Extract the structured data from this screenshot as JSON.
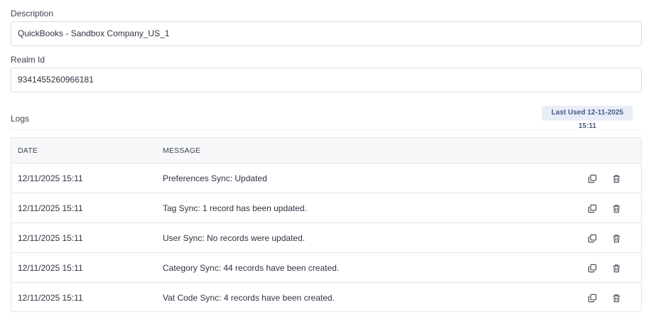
{
  "description": {
    "label": "Description",
    "value": "QuickBooks - Sandbox Company_US_1"
  },
  "realm": {
    "label": "Realm Id",
    "value": "9341455260966181"
  },
  "logs": {
    "title": "Logs",
    "last_used_badge": "Last Used 12-11-2025 15:11",
    "columns": {
      "date": "DATE",
      "message": "MESSAGE"
    },
    "rows": [
      {
        "date": "12/11/2025 15:11",
        "message": "Preferences Sync: Updated"
      },
      {
        "date": "12/11/2025 15:11",
        "message": "Tag Sync: 1 record has been updated."
      },
      {
        "date": "12/11/2025 15:11",
        "message": "User Sync: No records were updated."
      },
      {
        "date": "12/11/2025 15:11",
        "message": "Category Sync: 44 records have been created."
      },
      {
        "date": "12/11/2025 15:11",
        "message": "Vat Code Sync: 4 records have been created."
      }
    ]
  },
  "icons": {
    "copy": "copy-icon",
    "delete": "trash-icon"
  },
  "colors": {
    "badge_bg": "#e8edf8",
    "badge_text": "#4a5a86",
    "border": "#e3e6ea"
  }
}
